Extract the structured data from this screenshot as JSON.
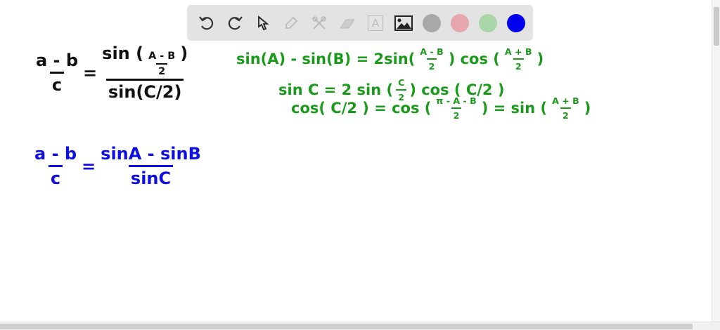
{
  "toolbar": {
    "tools": [
      "undo-icon",
      "redo-icon",
      "select-arrow-icon",
      "pen-icon",
      "tools-icon",
      "eraser-icon",
      "text-icon",
      "image-icon"
    ],
    "colors": {
      "gray": "#a8a8a8",
      "pink": "#e6a6ad",
      "green": "#a9d6a9",
      "blue": "#0000ee"
    },
    "text_tool_label": "A"
  },
  "board": {
    "black_eq": {
      "lhs_num": "a - b",
      "lhs_den": "c",
      "eq": "=",
      "rhs_num_fn": "sin (",
      "rhs_num_frac_num": "A - B",
      "rhs_num_frac_den": "2",
      "rhs_num_close": ")",
      "rhs_den": "sin(C/2)"
    },
    "green1": {
      "a": "sin(A) - sin(B) = 2sin(",
      "f1n": "A - B",
      "f1d": "2",
      "b": ") cos (",
      "f2n": "A + B",
      "f2d": "2",
      "c": ")"
    },
    "green2": {
      "a": "sin C = 2 sin (",
      "fn": "C",
      "fd": "2",
      "b": ") cos ( C/2 )"
    },
    "green3": {
      "a": "cos( C/2 ) = cos (",
      "f1n": "π - A - B",
      "f1d": "2",
      "b": ") = sin (",
      "f2n": "A + B",
      "f2d": "2",
      "c": ")"
    },
    "blue_eq": {
      "lhs_num": "a - b",
      "lhs_den": "c",
      "eq": "=",
      "rhs_num": "sinA - sinB",
      "rhs_den": "sinC"
    }
  }
}
